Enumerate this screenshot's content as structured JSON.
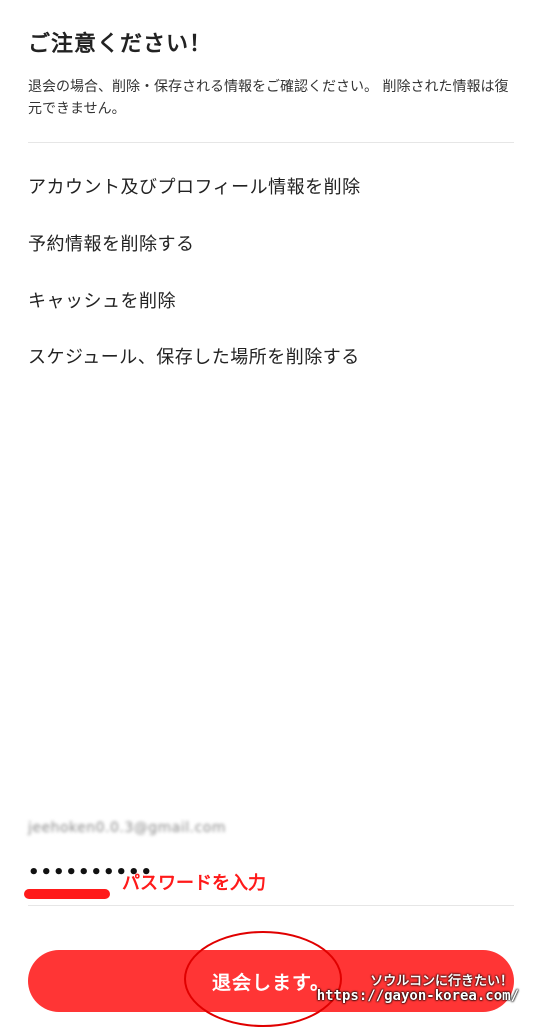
{
  "header": {
    "title": "ご注意ください！",
    "description": "退会の場合、削除・保存される情報をご確認ください。 削除された情報は復元できません。"
  },
  "deletion_items": [
    "アカウント及びプロフィール情報を削除",
    "予約情報を削除する",
    "キャッシュを削除",
    "スケジュール、保存した場所を削除する"
  ],
  "account": {
    "email": "jeehoken0.0.3@gmail.com",
    "password_value": "••••••••••",
    "password_note": "パスワードを入力"
  },
  "actions": {
    "withdraw_label": "退会します。"
  },
  "watermark": {
    "line1": "ソウルコンに行きたい！",
    "line2": "https://gayon-korea.com/"
  },
  "colors": {
    "accent": "#ff3535",
    "annotation": "#ff1a1a"
  }
}
